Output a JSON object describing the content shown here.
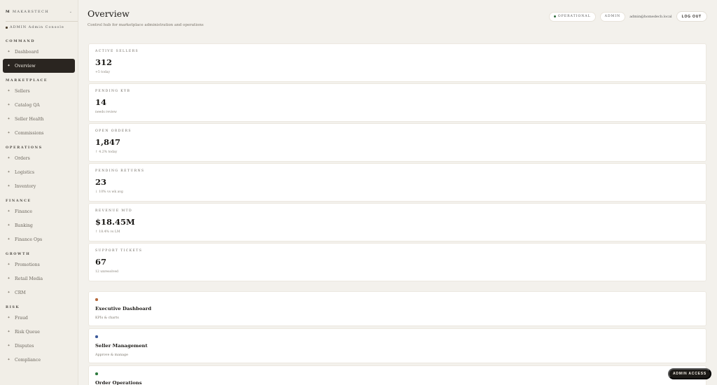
{
  "brand": {
    "mark": "M",
    "name": "MAKARSTECH",
    "console": "ADMIN Admin Console"
  },
  "sidebar": {
    "sections": [
      {
        "title": "COMMAND",
        "items": [
          {
            "label": "Dashboard",
            "icon": "sparkle-icon"
          },
          {
            "label": "Overview",
            "icon": "sparkle-icon",
            "active": true
          }
        ]
      },
      {
        "title": "MARKETPLACE",
        "items": [
          {
            "label": "Sellers"
          },
          {
            "label": "Catalog QA"
          },
          {
            "label": "Seller Health"
          },
          {
            "label": "Commissions"
          }
        ]
      },
      {
        "title": "OPERATIONS",
        "items": [
          {
            "label": "Orders"
          },
          {
            "label": "Logistics"
          },
          {
            "label": "Inventory"
          }
        ]
      },
      {
        "title": "FINANCE",
        "items": [
          {
            "label": "Finance"
          },
          {
            "label": "Banking"
          },
          {
            "label": "Finance Ops"
          }
        ]
      },
      {
        "title": "GROWTH",
        "items": [
          {
            "label": "Promotions"
          },
          {
            "label": "Retail Media"
          },
          {
            "label": "CRM"
          }
        ]
      },
      {
        "title": "RISK",
        "items": [
          {
            "label": "Fraud"
          },
          {
            "label": "Risk Queue"
          },
          {
            "label": "Disputes"
          },
          {
            "label": "Compliance"
          }
        ]
      }
    ]
  },
  "header": {
    "title": "Overview",
    "subtitle": "Control hub for marketplace administration and operations",
    "status": "OPERATIONAL",
    "role": "ADMIN",
    "email": "admin@homedecb.local",
    "logout": "LOG OUT"
  },
  "kpis": [
    {
      "label": "ACTIVE SELLERS",
      "value": "312",
      "sub": "+5 today"
    },
    {
      "label": "PENDING KYB",
      "value": "14",
      "sub": "needs review"
    },
    {
      "label": "OPEN ORDERS",
      "value": "1,847",
      "sub": "↑ 4.2% today"
    },
    {
      "label": "PENDING RETURNS",
      "value": "23",
      "sub": "↓ 10% vs wk avg"
    },
    {
      "label": "REVENUE MTD",
      "value": "$18.45M",
      "sub": "↑ 18.4% vs LM"
    },
    {
      "label": "SUPPORT TICKETS",
      "value": "67",
      "sub": "12 unresolved"
    }
  ],
  "modules": [
    {
      "title": "Executive Dashboard",
      "sub": "KPIs & charts",
      "color": "#b5683a"
    },
    {
      "title": "Seller Management",
      "sub": "Approve & manage",
      "color": "#3c5a9a"
    },
    {
      "title": "Order Operations",
      "sub": "",
      "color": "#2e7a3e"
    }
  ],
  "admin_access": "ADMIN ACCESS"
}
